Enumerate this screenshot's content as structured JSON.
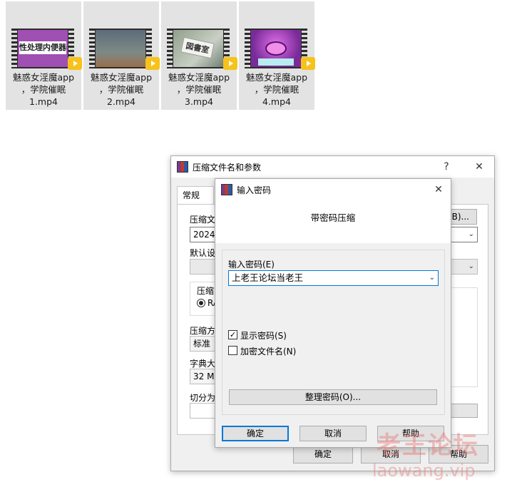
{
  "files": [
    {
      "name": "魅惑女淫魔app，学院催眠1.mp4",
      "line1": "魅惑女淫魔app",
      "line2": "，学院催眠",
      "line3": "1.mp4",
      "caption": "性处理内便器",
      "badge": "Player"
    },
    {
      "name": "魅惑女淫魔app，学院催眠2.mp4",
      "line1": "魅惑女淫魔app",
      "line2": "，学院催眠",
      "line3": "2.mp4",
      "caption": "",
      "badge": "Player"
    },
    {
      "name": "魅惑女淫魔app，学院催眠3.mp4",
      "line1": "魅惑女淫魔app",
      "line2": "，学院催眠",
      "line3": "3.mp4",
      "caption": "図書室",
      "badge": "Player"
    },
    {
      "name": "魅惑女淫魔app，学院催眠4.mp4",
      "line1": "魅惑女淫魔app",
      "line2": "，学院催眠",
      "line3": "4.mp4",
      "caption": "",
      "badge": "Player"
    }
  ],
  "back_dialog": {
    "title": "压缩文件名和参数",
    "help_btn": "?",
    "close_btn": "✕",
    "tab_general": "常规",
    "archive_label": "压缩文",
    "archive_value": "20240",
    "browse_btn": "(B)...",
    "profile_label": "默认设",
    "format_label": "压缩",
    "format_rar": "RA",
    "method_label": "压缩方",
    "method_value": "标准",
    "dict_label": "字典大",
    "dict_value": "32 MB",
    "split_label": "切分为",
    "ok_btn": "确定",
    "cancel_btn": "取消",
    "help_bottom_btn": "帮助"
  },
  "front_dialog": {
    "title": "输入密码",
    "close_btn": "✕",
    "heading": "带密码压缩",
    "password_label": "输入密码(E)",
    "password_value": "上老王论坛当老王",
    "show_password_label": "显示密码(S)",
    "show_password_checked": true,
    "encrypt_names_label": "加密文件名(N)",
    "encrypt_names_checked": false,
    "organize_btn": "整理密码(O)...",
    "ok_btn": "确定",
    "cancel_btn": "取消",
    "help_btn": "帮助"
  },
  "watermark": {
    "line1": "老王论坛",
    "line2": "laowang.vip"
  },
  "colors": {
    "accent": "#0078d7",
    "dialog_bg": "#f0f0f0",
    "watermark": "#eb7878"
  }
}
